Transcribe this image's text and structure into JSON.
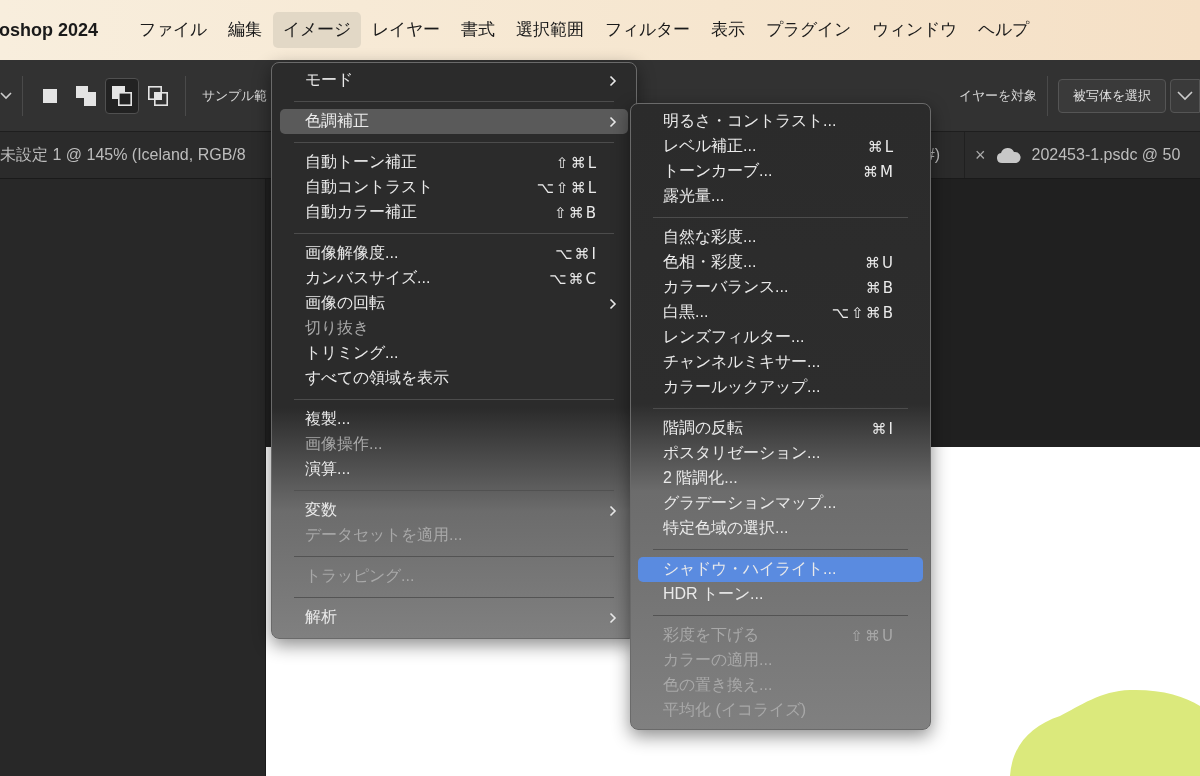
{
  "menubar": {
    "app_name": "oshop 2024",
    "menus": [
      {
        "label": "ファイル",
        "selected": false
      },
      {
        "label": "編集",
        "selected": false
      },
      {
        "label": "イメージ",
        "selected": true
      },
      {
        "label": "レイヤー",
        "selected": false
      },
      {
        "label": "書式",
        "selected": false
      },
      {
        "label": "選択範囲",
        "selected": false
      },
      {
        "label": "フィルター",
        "selected": false
      },
      {
        "label": "表示",
        "selected": false
      },
      {
        "label": "プラグイン",
        "selected": false
      },
      {
        "label": "ウィンドウ",
        "selected": false
      },
      {
        "label": "ヘルプ",
        "selected": false
      }
    ]
  },
  "options_bar": {
    "shape_modes": [
      {
        "kind": "new",
        "selected": false
      },
      {
        "kind": "add",
        "selected": false
      },
      {
        "kind": "subtract",
        "selected": true
      },
      {
        "kind": "intersect",
        "selected": false
      }
    ],
    "sample_label": "サンプル範",
    "layer_label": "イヤーを対象",
    "select_subject_button": "被写体を選択"
  },
  "document_tabs": [
    {
      "title_parts": [
        "未設定 1 @ 145% (Iceland, RGB/8",
        "#)"
      ],
      "cloud": false
    },
    {
      "title_parts": [
        "202453-1.psdc @ 50"
      ],
      "close": "×",
      "cloud": true
    }
  ],
  "image_menu": {
    "items": [
      {
        "kind": "item",
        "label": "モード",
        "submenu": true,
        "disabled": false,
        "selected": false
      },
      {
        "kind": "separator"
      },
      {
        "kind": "item",
        "label": "色調補正",
        "submenu": true,
        "disabled": false,
        "selected": true
      },
      {
        "kind": "separator"
      },
      {
        "kind": "item",
        "label": "自動トーン補正",
        "shortcut": "⇧⌘L",
        "submenu": false,
        "disabled": false,
        "selected": false
      },
      {
        "kind": "item",
        "label": "自動コントラスト",
        "shortcut": "⌥⇧⌘L",
        "submenu": false,
        "disabled": false,
        "selected": false
      },
      {
        "kind": "item",
        "label": "自動カラー補正",
        "shortcut": "⇧⌘B",
        "submenu": false,
        "disabled": false,
        "selected": false
      },
      {
        "kind": "separator"
      },
      {
        "kind": "item",
        "label": "画像解像度...",
        "shortcut": "⌥⌘I",
        "submenu": false,
        "disabled": false,
        "selected": false
      },
      {
        "kind": "item",
        "label": "カンバスサイズ...",
        "shortcut": "⌥⌘C",
        "submenu": false,
        "disabled": false,
        "selected": false
      },
      {
        "kind": "item",
        "label": "画像の回転",
        "submenu": true,
        "disabled": false,
        "selected": false
      },
      {
        "kind": "item",
        "label": "切り抜き",
        "submenu": false,
        "disabled": true,
        "selected": false
      },
      {
        "kind": "item",
        "label": "トリミング...",
        "submenu": false,
        "disabled": false,
        "selected": false
      },
      {
        "kind": "item",
        "label": "すべての領域を表示",
        "submenu": false,
        "disabled": false,
        "selected": false
      },
      {
        "kind": "separator"
      },
      {
        "kind": "item",
        "label": "複製...",
        "submenu": false,
        "disabled": false,
        "selected": false
      },
      {
        "kind": "item",
        "label": "画像操作...",
        "submenu": false,
        "disabled": true,
        "selected": false
      },
      {
        "kind": "item",
        "label": "演算...",
        "submenu": false,
        "disabled": false,
        "selected": false
      },
      {
        "kind": "separator"
      },
      {
        "kind": "item",
        "label": "変数",
        "submenu": true,
        "disabled": false,
        "selected": false
      },
      {
        "kind": "item",
        "label": "データセットを適用...",
        "submenu": false,
        "disabled": true,
        "selected": false
      },
      {
        "kind": "separator"
      },
      {
        "kind": "item",
        "label": "トラッピング...",
        "submenu": false,
        "disabled": true,
        "selected": false
      },
      {
        "kind": "separator"
      },
      {
        "kind": "item",
        "label": "解析",
        "submenu": true,
        "disabled": false,
        "selected": false
      }
    ]
  },
  "adjustments_submenu": {
    "items": [
      {
        "kind": "item",
        "label": "明るさ・コントラスト...",
        "disabled": false,
        "selected": false
      },
      {
        "kind": "item",
        "label": "レベル補正...",
        "shortcut": "⌘L",
        "disabled": false,
        "selected": false
      },
      {
        "kind": "item",
        "label": "トーンカーブ...",
        "shortcut": "⌘M",
        "disabled": false,
        "selected": false
      },
      {
        "kind": "item",
        "label": "露光量...",
        "disabled": false,
        "selected": false
      },
      {
        "kind": "separator"
      },
      {
        "kind": "item",
        "label": "自然な彩度...",
        "disabled": false,
        "selected": false
      },
      {
        "kind": "item",
        "label": "色相・彩度...",
        "shortcut": "⌘U",
        "disabled": false,
        "selected": false
      },
      {
        "kind": "item",
        "label": "カラーバランス...",
        "shortcut": "⌘B",
        "disabled": false,
        "selected": false
      },
      {
        "kind": "item",
        "label": "白黒...",
        "shortcut": "⌥⇧⌘B",
        "disabled": false,
        "selected": false
      },
      {
        "kind": "item",
        "label": "レンズフィルター...",
        "disabled": false,
        "selected": false
      },
      {
        "kind": "item",
        "label": "チャンネルミキサー...",
        "disabled": false,
        "selected": false
      },
      {
        "kind": "item",
        "label": "カラールックアップ...",
        "disabled": false,
        "selected": false
      },
      {
        "kind": "separator"
      },
      {
        "kind": "item",
        "label": "階調の反転",
        "shortcut": "⌘I",
        "disabled": false,
        "selected": false
      },
      {
        "kind": "item",
        "label": "ポスタリゼーション...",
        "disabled": false,
        "selected": false
      },
      {
        "kind": "item",
        "label": "2 階調化...",
        "disabled": false,
        "selected": false
      },
      {
        "kind": "item",
        "label": "グラデーションマップ...",
        "disabled": false,
        "selected": false
      },
      {
        "kind": "item",
        "label": "特定色域の選択...",
        "disabled": false,
        "selected": false
      },
      {
        "kind": "separator"
      },
      {
        "kind": "item",
        "label": "シャドウ・ハイライト...",
        "disabled": false,
        "selected": true
      },
      {
        "kind": "item",
        "label": "HDR トーン...",
        "disabled": false,
        "selected": false
      },
      {
        "kind": "separator"
      },
      {
        "kind": "item",
        "label": "彩度を下げる",
        "shortcut": "⇧⌘U",
        "disabled": true,
        "selected": false
      },
      {
        "kind": "item",
        "label": "カラーの適用...",
        "disabled": true,
        "selected": false
      },
      {
        "kind": "item",
        "label": "色の置き換え...",
        "disabled": true,
        "selected": false
      },
      {
        "kind": "item",
        "label": "平均化 (イコライズ)",
        "disabled": true,
        "selected": false
      }
    ]
  }
}
